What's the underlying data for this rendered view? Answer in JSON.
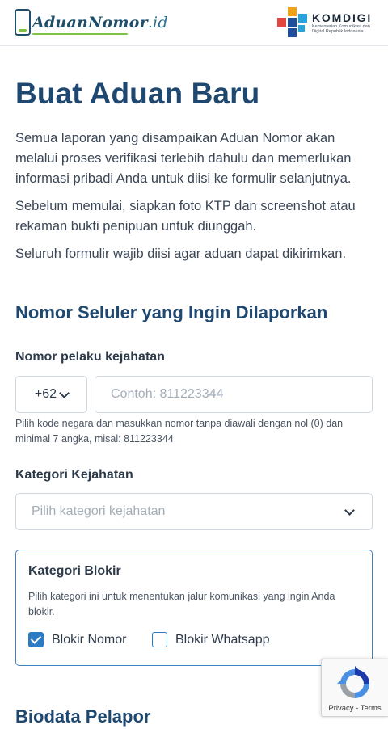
{
  "header": {
    "brand_main": "AduanNomor",
    "brand_suffix": ".id",
    "partner_name": "KOMDIGI",
    "partner_sub": "Kementerian Komunikasi dan Digital Republik Indonesia"
  },
  "page": {
    "title": "Buat Aduan Baru",
    "intro_1": "Semua laporan yang disampaikan Aduan Nomor akan melalui proses verifikasi terlebih dahulu dan memerlukan informasi pribadi Anda untuk diisi ke formulir selanjutnya.",
    "intro_2": "Sebelum memulai, siapkan foto KTP dan screenshot atau rekaman bukti penipuan untuk diunggah.",
    "intro_3": "Seluruh formulir wajib diisi agar aduan dapat dikirimkan."
  },
  "section_reported": {
    "title": "Nomor Seluler yang Ingin Dilaporkan",
    "phone_label": "Nomor pelaku kejahatan",
    "country_code": "+62",
    "phone_placeholder": "Contoh: 811223344",
    "phone_hint": "Pilih kode negara dan masukkan nomor tanpa diawali dengan nol (0) dan minimal 7 angka, misal: 811223344",
    "category_label": "Kategori Kejahatan",
    "category_placeholder": "Pilih kategori kejahatan"
  },
  "block_category": {
    "title": "Kategori Blokir",
    "description": "Pilih kategori ini untuk menentukan jalur komunikasi yang ingin Anda blokir.",
    "options": [
      {
        "label": "Blokir Nomor",
        "checked": true
      },
      {
        "label": "Blokir Whatsapp",
        "checked": false
      }
    ]
  },
  "section_reporter": {
    "title": "Biodata Pelapor"
  },
  "recaptcha": {
    "links": "Privacy - Terms"
  },
  "colors": {
    "heading": "#1f4870",
    "accent": "#2b7bc4",
    "brand_green": "#7dc243"
  }
}
